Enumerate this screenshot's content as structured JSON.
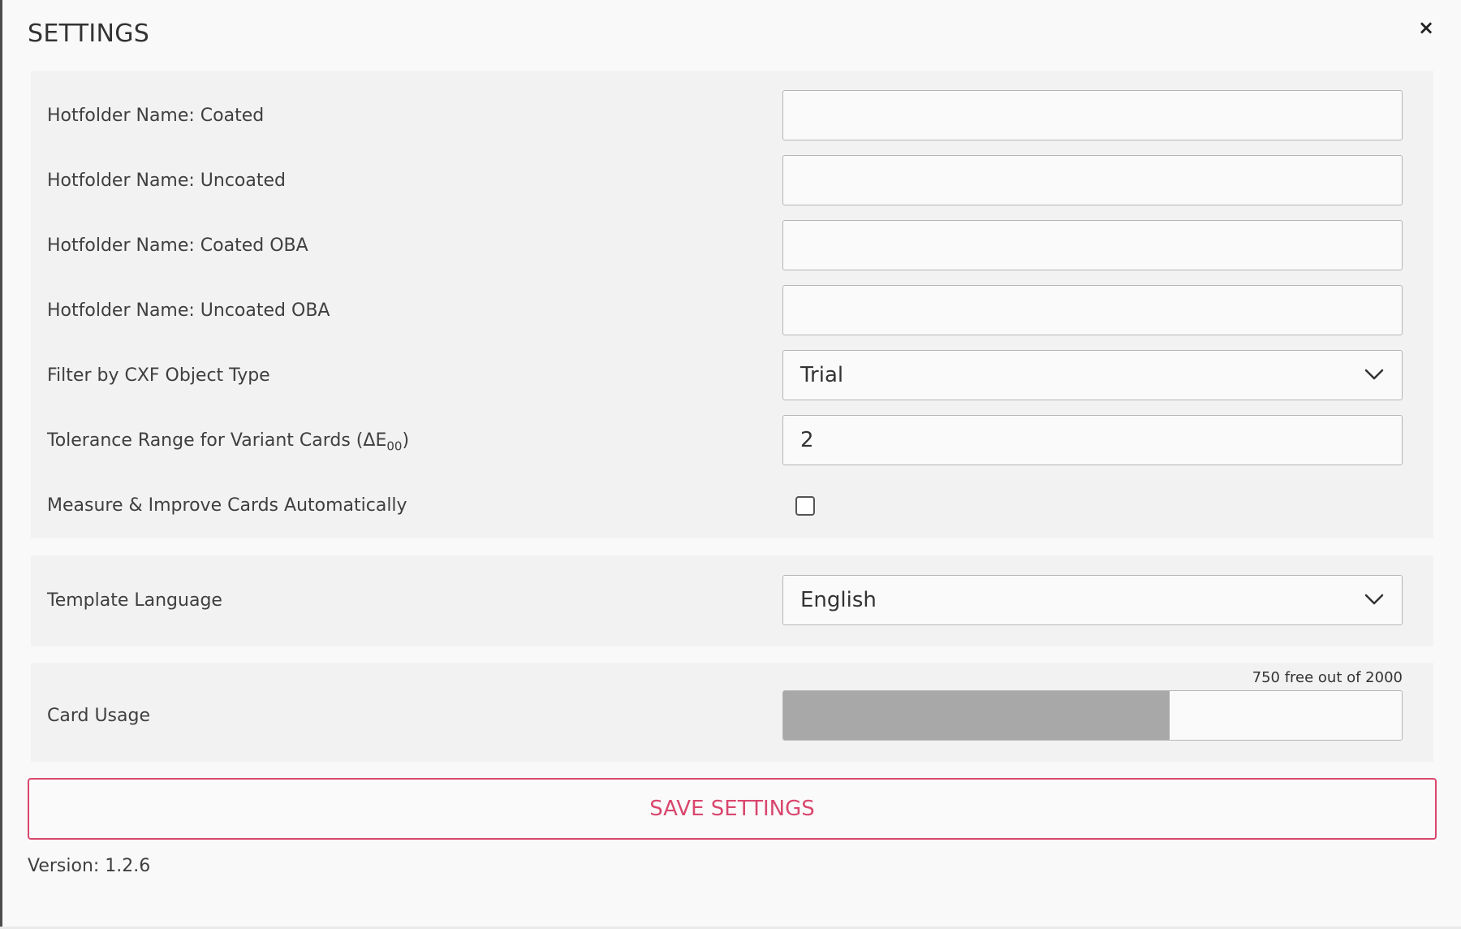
{
  "dialog": {
    "title": "SETTINGS",
    "close_glyph": "×"
  },
  "settings": {
    "hotfolder_coated": {
      "label": "Hotfolder Name: Coated",
      "value": ""
    },
    "hotfolder_uncoated": {
      "label": "Hotfolder Name: Uncoated",
      "value": ""
    },
    "hotfolder_coated_oba": {
      "label": "Hotfolder Name: Coated OBA",
      "value": ""
    },
    "hotfolder_uncoated_oba": {
      "label": "Hotfolder Name: Uncoated OBA",
      "value": ""
    },
    "filter_cxf": {
      "label": "Filter by CXF Object Type",
      "selected": "Trial"
    },
    "tolerance": {
      "label_main": "Tolerance Range for Variant Cards (ΔE",
      "label_sub": "00",
      "label_end": ")",
      "value": "2"
    },
    "measure_auto": {
      "label": "Measure & Improve Cards Automatically",
      "checked": false
    }
  },
  "language": {
    "label": "Template Language",
    "selected": "English"
  },
  "usage": {
    "label": "Card Usage",
    "text": "750 free out of 2000",
    "used_fraction": 0.625
  },
  "save_button": {
    "label": "SAVE SETTINGS"
  },
  "version": {
    "text": "Version: 1.2.6"
  },
  "colors": {
    "accent": "#d9476e",
    "usage_fill": "#a8a8a8"
  },
  "icons": {
    "close": "close-icon",
    "dropdown": "chevron-down-icon"
  }
}
